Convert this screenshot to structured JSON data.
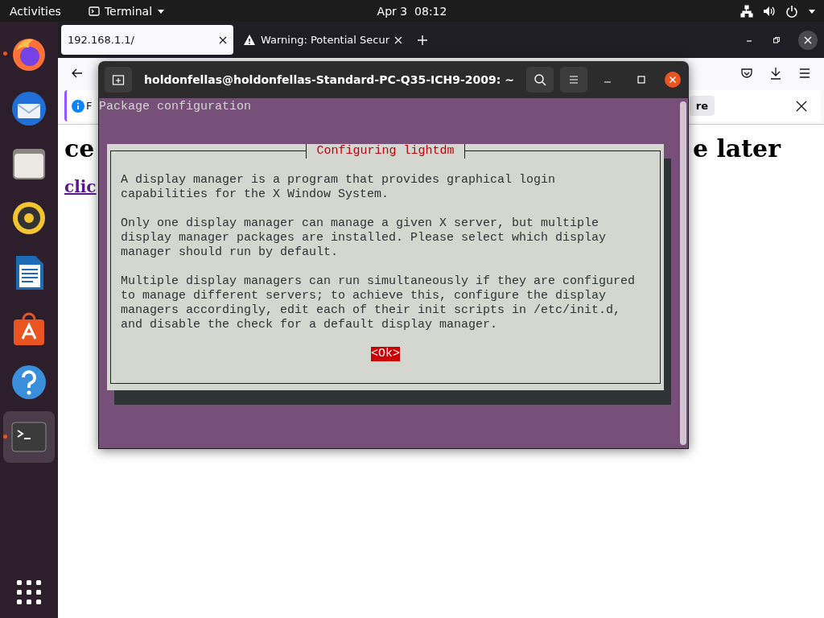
{
  "top_bar": {
    "activities": "Activities",
    "app_menu": "Terminal",
    "clock": "Apr 3  08:12"
  },
  "dock": {
    "items": [
      {
        "kind": "firefox",
        "running": true,
        "selected": false
      },
      {
        "kind": "thunderbird",
        "running": false,
        "selected": false
      },
      {
        "kind": "files",
        "running": false,
        "selected": false
      },
      {
        "kind": "rhythmbox",
        "running": false,
        "selected": false
      },
      {
        "kind": "writer",
        "running": false,
        "selected": false
      },
      {
        "kind": "software",
        "running": false,
        "selected": false
      },
      {
        "kind": "help",
        "running": false,
        "selected": false
      },
      {
        "kind": "terminal",
        "running": true,
        "selected": true
      }
    ]
  },
  "browser": {
    "tabs": [
      {
        "title": "192.168.1.1/",
        "kind": "page",
        "selected": true
      },
      {
        "title": "Warning: Potential Secur",
        "kind": "warning",
        "selected": false
      }
    ],
    "notification": {
      "text": "F",
      "button": "re"
    },
    "page": {
      "heading_left": "ce",
      "heading_right": "e later",
      "link": "clic"
    }
  },
  "terminal": {
    "title": "holdonfellas@holdonfellas-Standard-PC-Q35-ICH9-2009: ~",
    "header": "Package configuration",
    "dialog": {
      "title": "Configuring lightdm",
      "paragraphs": [
        "A display manager is a program that provides graphical login\ncapabilities for the X Window System.",
        "Only one display manager can manage a given X server, but multiple\ndisplay manager packages are installed. Please select which display\nmanager should run by default.",
        "Multiple display managers can run simultaneously if they are configured\nto manage different servers; to achieve this, configure the display\nmanagers accordingly, edit each of their init scripts in /etc/init.d,\nand disable the check for a default display manager."
      ],
      "button": {
        "label": "<Ok>",
        "selected": true
      }
    }
  }
}
